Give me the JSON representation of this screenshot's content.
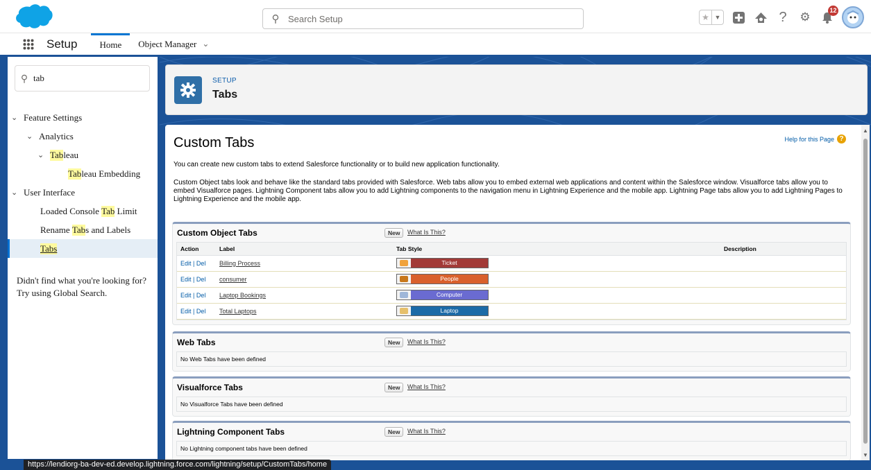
{
  "header": {
    "search_placeholder": "Search Setup",
    "notification_count": "12",
    "icons": [
      "salesforce-cloud-icon",
      "search-icon",
      "star-icon",
      "chevron-down-icon",
      "add-icon",
      "trailhead-icon",
      "help-icon",
      "gear-icon",
      "bell-icon",
      "avatar"
    ]
  },
  "nav": {
    "app_name": "Setup",
    "tabs": [
      {
        "label": "Home",
        "active": true
      },
      {
        "label": "Object Manager",
        "active": false
      }
    ]
  },
  "sidebar": {
    "quickfind_value": "tab",
    "tree": {
      "feature_settings": "Feature Settings",
      "analytics": "Analytics",
      "tableau_hl": "Tab",
      "tableau_rest": "leau",
      "emb_hl": "Tab",
      "emb_rest": "leau Embedding",
      "user_interface": "User Interface",
      "console_pre": "Loaded Console ",
      "console_hl": "Tab",
      "console_post": " Limit",
      "rename_pre": "Rename ",
      "rename_hl": "Tab",
      "rename_post": "s and Labels",
      "tabs_hl": "Tabs"
    },
    "not_found_line1": "Didn't find what you're looking for?",
    "not_found_line2": "Try using Global Search."
  },
  "page_header": {
    "eyebrow": "SETUP",
    "title": "Tabs"
  },
  "content": {
    "title": "Custom Tabs",
    "help_link": "Help for this Page",
    "intro1": "You can create new custom tabs to extend Salesforce functionality or to build new application functionality.",
    "intro2": "Custom Object tabs look and behave like the standard tabs provided with Salesforce. Web tabs allow you to embed external web applications and content within the Salesforce window. Visualforce tabs allow you to embed Visualforce pages. Lightning Component tabs allow you to add Lightning components to the navigation menu in Lightning Experience and the mobile app. Lightning Page tabs allow you to add Lightning Pages to Lightning Experience and the mobile app.",
    "new_label": "New",
    "what_label": "What Is This?",
    "edit_label": "Edit",
    "sep": " | ",
    "del_label": "Del",
    "custom_object": {
      "title": "Custom Object Tabs",
      "columns": [
        "Action",
        "Label",
        "Tab Style",
        "Description"
      ],
      "rows": [
        {
          "label": "Billing Process",
          "style": "Ticket",
          "color": "#a23a37",
          "icon": "#f0a23b"
        },
        {
          "label": "consumer",
          "style": "People",
          "color": "#d9602b",
          "icon": "#c8781b"
        },
        {
          "label": "Laptop Bookings",
          "style": "Computer",
          "color": "#6a6bd1",
          "icon": "#9fb7d9"
        },
        {
          "label": "Total Laptops",
          "style": "Laptop",
          "color": "#1c6ba7",
          "icon": "#e6c06b"
        }
      ]
    },
    "web": {
      "title": "Web Tabs",
      "empty": "No Web Tabs have been defined"
    },
    "visualforce": {
      "title": "Visualforce Tabs",
      "empty": "No Visualforce Tabs have been defined"
    },
    "lightning": {
      "title": "Lightning Component Tabs",
      "empty": "No Lightning component tabs have been defined"
    }
  },
  "status_url": "https://lendiorg-ba-dev-ed.develop.lightning.force.com/lightning/setup/CustomTabs/home"
}
